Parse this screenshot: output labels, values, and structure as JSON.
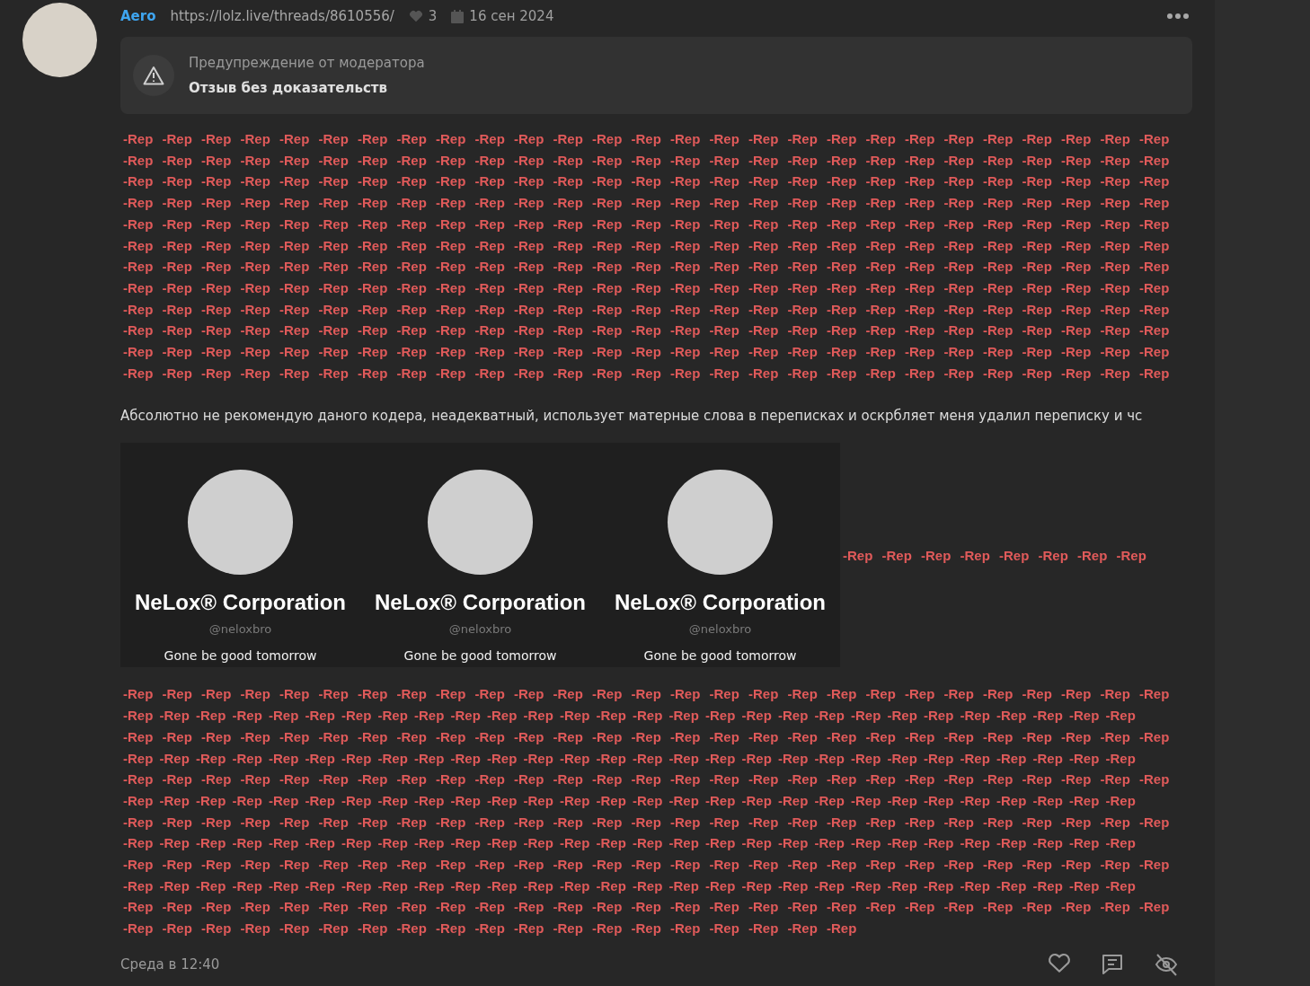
{
  "post": {
    "author": "Aero",
    "link": "https://lolz.live/threads/8610556/",
    "likes": "3",
    "date": "16 сен 2024",
    "warning": {
      "title": "Предупреждение от модератора",
      "text": "Отзыв без доказательств"
    },
    "rep_block_1": [
      "-Rep -Rep -Rep -Rep -Rep -Rep -Rep -Rep -Rep -Rep -Rep -Rep -Rep -Rep -Rep -Rep -Rep -Rep -Rep -Rep -Rep -Rep -Rep -Rep -Rep -Rep -Rep",
      "-Rep -Rep -Rep -Rep -Rep -Rep -Rep -Rep -Rep -Rep -Rep -Rep -Rep -Rep -Rep -Rep -Rep -Rep -Rep -Rep -Rep -Rep -Rep -Rep -Rep -Rep -Rep",
      "-Rep -Rep -Rep -Rep -Rep -Rep -Rep -Rep -Rep -Rep -Rep -Rep -Rep -Rep -Rep -Rep -Rep -Rep -Rep -Rep -Rep -Rep -Rep -Rep -Rep -Rep -Rep",
      "-Rep -Rep -Rep -Rep -Rep -Rep -Rep -Rep -Rep -Rep -Rep -Rep -Rep -Rep -Rep -Rep -Rep -Rep -Rep -Rep -Rep -Rep -Rep -Rep -Rep -Rep -Rep",
      "-Rep -Rep -Rep -Rep -Rep -Rep -Rep -Rep -Rep -Rep -Rep -Rep -Rep -Rep -Rep -Rep -Rep -Rep -Rep -Rep -Rep -Rep -Rep -Rep -Rep -Rep -Rep",
      "-Rep -Rep -Rep -Rep -Rep -Rep -Rep -Rep -Rep -Rep -Rep -Rep -Rep -Rep -Rep -Rep -Rep -Rep -Rep -Rep -Rep -Rep -Rep -Rep -Rep -Rep -Rep",
      "-Rep -Rep -Rep -Rep -Rep -Rep -Rep -Rep -Rep -Rep -Rep -Rep -Rep -Rep -Rep -Rep -Rep -Rep -Rep -Rep -Rep -Rep -Rep -Rep -Rep -Rep -Rep",
      "-Rep -Rep -Rep -Rep -Rep -Rep -Rep -Rep -Rep -Rep -Rep -Rep -Rep -Rep -Rep -Rep -Rep -Rep -Rep -Rep -Rep -Rep -Rep -Rep -Rep -Rep -Rep",
      "-Rep -Rep -Rep -Rep -Rep -Rep -Rep -Rep -Rep -Rep -Rep -Rep -Rep -Rep -Rep -Rep -Rep -Rep -Rep -Rep -Rep -Rep -Rep -Rep -Rep -Rep -Rep",
      "-Rep -Rep -Rep -Rep -Rep -Rep -Rep -Rep -Rep -Rep -Rep -Rep -Rep -Rep -Rep -Rep -Rep -Rep -Rep -Rep -Rep -Rep -Rep -Rep -Rep -Rep -Rep",
      "-Rep -Rep -Rep -Rep -Rep -Rep -Rep -Rep -Rep -Rep -Rep -Rep -Rep -Rep -Rep -Rep -Rep -Rep -Rep -Rep -Rep -Rep -Rep -Rep -Rep -Rep -Rep",
      "-Rep -Rep -Rep -Rep -Rep -Rep -Rep -Rep -Rep -Rep -Rep -Rep -Rep -Rep -Rep -Rep -Rep -Rep -Rep -Rep -Rep -Rep -Rep -Rep -Rep -Rep -Rep"
    ],
    "message": "Абсолютно не рекомендую даного кодера, неадекватный, использует матерные слова в переписках и оскрбляет меня удалил переписку и чс",
    "profile_cards": [
      {
        "name": "NeLox® Corporation",
        "handle": "@neloxbro",
        "status": "Gone be good tomorrow"
      },
      {
        "name": "NeLox® Corporation",
        "handle": "@neloxbro",
        "status": "Gone be good tomorrow"
      },
      {
        "name": "NeLox® Corporation",
        "handle": "@neloxbro",
        "status": "Gone be good tomorrow"
      }
    ],
    "rep_inline": "-Rep -Rep -Rep -Rep -Rep -Rep -Rep -Rep",
    "rep_block_2": [
      "-Rep -Rep -Rep -Rep -Rep -Rep -Rep -Rep -Rep -Rep -Rep -Rep -Rep -Rep -Rep -Rep -Rep -Rep -Rep -Rep -Rep -Rep -Rep -Rep -Rep -Rep -Rep",
      "-Rep -Rep -Rep -Rep -Rep -Rep -Rep -Rep -Rep -Rep -Rep -Rep -Rep -Rep -Rep -Rep -Rep -Rep -Rep -Rep -Rep -Rep -Rep -Rep -Rep -Rep -Rep -Rep",
      "-Rep -Rep -Rep -Rep -Rep -Rep -Rep -Rep -Rep -Rep -Rep -Rep -Rep -Rep -Rep -Rep -Rep -Rep -Rep -Rep -Rep -Rep -Rep -Rep -Rep -Rep -Rep",
      "-Rep -Rep -Rep -Rep -Rep -Rep -Rep -Rep -Rep -Rep -Rep -Rep -Rep -Rep -Rep -Rep -Rep -Rep -Rep -Rep -Rep -Rep -Rep -Rep -Rep -Rep -Rep -Rep",
      "-Rep -Rep -Rep -Rep -Rep -Rep -Rep -Rep -Rep -Rep -Rep -Rep -Rep -Rep -Rep -Rep -Rep -Rep -Rep -Rep -Rep -Rep -Rep -Rep -Rep -Rep -Rep",
      "-Rep -Rep -Rep -Rep -Rep -Rep -Rep -Rep -Rep -Rep -Rep -Rep -Rep -Rep -Rep -Rep -Rep -Rep -Rep -Rep -Rep -Rep -Rep -Rep -Rep -Rep -Rep -Rep",
      "-Rep -Rep -Rep -Rep -Rep -Rep -Rep -Rep -Rep -Rep -Rep -Rep -Rep -Rep -Rep -Rep -Rep -Rep -Rep -Rep -Rep -Rep -Rep -Rep -Rep -Rep -Rep",
      "-Rep -Rep -Rep -Rep -Rep -Rep -Rep -Rep -Rep -Rep -Rep -Rep -Rep -Rep -Rep -Rep -Rep -Rep -Rep -Rep -Rep -Rep -Rep -Rep -Rep -Rep -Rep -Rep",
      "-Rep -Rep -Rep -Rep -Rep -Rep -Rep -Rep -Rep -Rep -Rep -Rep -Rep -Rep -Rep -Rep -Rep -Rep -Rep -Rep -Rep -Rep -Rep -Rep -Rep -Rep -Rep",
      "-Rep -Rep -Rep -Rep -Rep -Rep -Rep -Rep -Rep -Rep -Rep -Rep -Rep -Rep -Rep -Rep -Rep -Rep -Rep -Rep -Rep -Rep -Rep -Rep -Rep -Rep -Rep -Rep",
      "-Rep -Rep -Rep -Rep -Rep -Rep -Rep -Rep -Rep -Rep -Rep -Rep -Rep -Rep -Rep -Rep -Rep -Rep -Rep -Rep -Rep -Rep -Rep -Rep -Rep -Rep -Rep",
      "-Rep -Rep -Rep -Rep -Rep -Rep -Rep -Rep -Rep -Rep -Rep -Rep -Rep -Rep -Rep -Rep -Rep -Rep -Rep"
    ],
    "time": "Среда в 12:40"
  }
}
